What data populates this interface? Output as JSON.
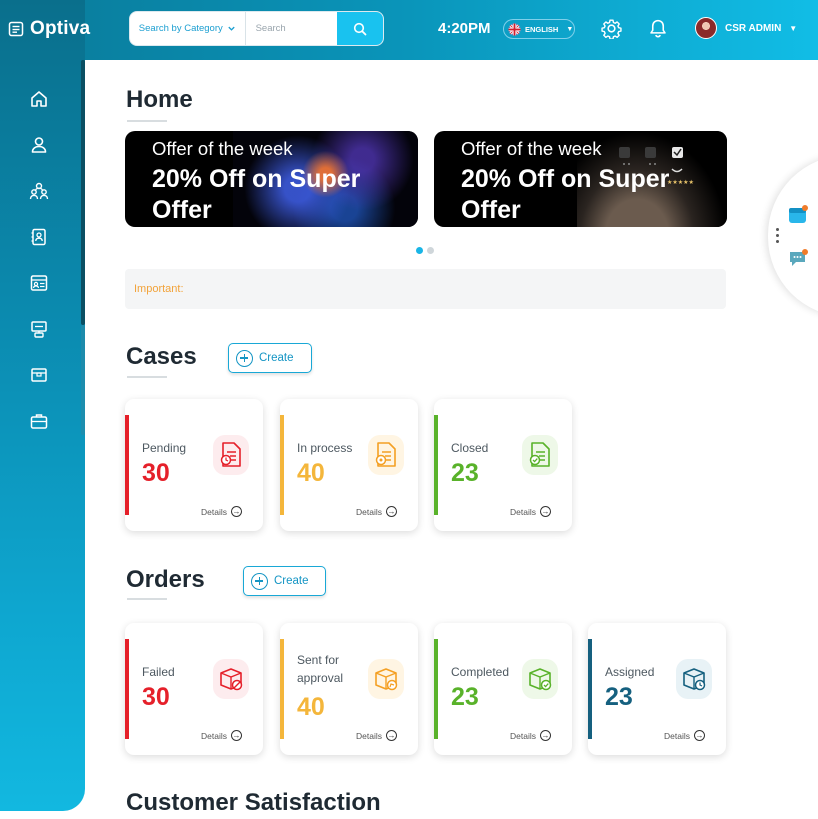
{
  "app": {
    "title": "Optiva"
  },
  "header": {
    "search_category": "Search by Category",
    "search_placeholder": "Search",
    "time": "4:20PM",
    "language": "ENGLISH",
    "user_name": "CSR ADMIN"
  },
  "sidebar": {
    "items": [
      {
        "icon": "home-icon"
      },
      {
        "icon": "user-icon"
      },
      {
        "icon": "users-group-icon"
      },
      {
        "icon": "contact-book-icon"
      },
      {
        "icon": "id-card-icon"
      },
      {
        "icon": "monitor-stack-icon"
      },
      {
        "icon": "store-icon"
      },
      {
        "icon": "briefcase-icon"
      }
    ]
  },
  "home": {
    "title": "Home",
    "banners": [
      {
        "line1": "Offer of the week",
        "line2": "20% Off on Super Offer"
      },
      {
        "line1": "Offer of the week",
        "line2": "20% Off on Super Offer"
      }
    ],
    "important_label": "Important:"
  },
  "cases": {
    "title": "Cases",
    "create_label": "Create",
    "cards": [
      {
        "label": "Pending",
        "value": "30",
        "color": "#e5202a",
        "details": "Details"
      },
      {
        "label": "In process",
        "value": "40",
        "color": "#f4b63b",
        "details": "Details"
      },
      {
        "label": "Closed",
        "value": "23",
        "color": "#59b22a",
        "details": "Details"
      }
    ]
  },
  "orders": {
    "title": "Orders",
    "create_label": "Create",
    "cards": [
      {
        "label": "Failed",
        "value": "30",
        "color": "#e5202a",
        "details": "Details"
      },
      {
        "label": "Sent for approval",
        "value": "40",
        "color": "#f4b63b",
        "details": "Details"
      },
      {
        "label": "Completed",
        "value": "23",
        "color": "#59b22a",
        "details": "Details"
      },
      {
        "label": "Assigned",
        "value": "23",
        "color": "#15607f",
        "details": "Details"
      }
    ]
  },
  "satisfaction": {
    "title": "Customer Satisfaction"
  }
}
